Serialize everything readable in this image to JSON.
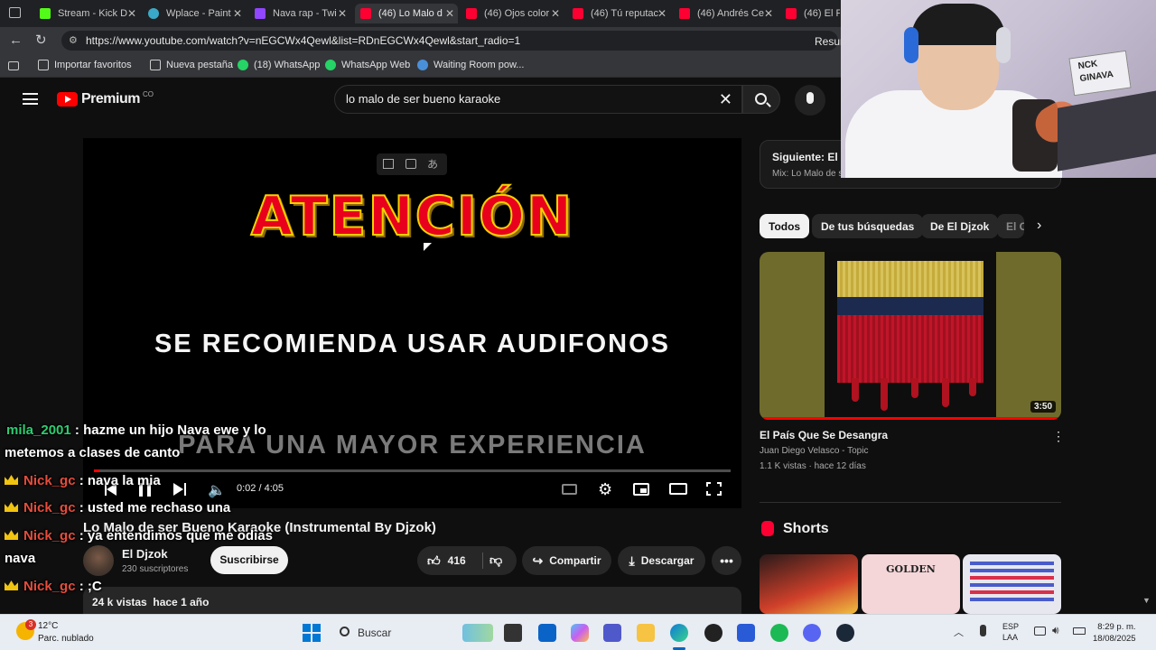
{
  "browser": {
    "tabs": [
      {
        "label": "Stream - Kick D",
        "color": "#53fc18"
      },
      {
        "label": "Wplace - Paint",
        "color": "#3aa9c9"
      },
      {
        "label": "Nava rap - Twi",
        "color": "#9146ff"
      },
      {
        "label": "(46) Lo Malo d",
        "color": "#ff0033",
        "active": true
      },
      {
        "label": "(46) Ojos color",
        "color": "#ff0033"
      },
      {
        "label": "(46) Tú reputac",
        "color": "#ff0033"
      },
      {
        "label": "(46) Andrés Ce",
        "color": "#ff0033"
      },
      {
        "label": "(46) El Pe",
        "color": "#ff0033"
      }
    ],
    "url": "https://www.youtube.com/watch?v=nEGCWx4Qewl&list=RDnEGCWx4Qewl&start_radio=1",
    "resume_label": "Resum",
    "bookmarks": [
      {
        "label": "Importar favoritos"
      },
      {
        "label": "Nueva pestaña"
      },
      {
        "label": "(18) WhatsApp"
      },
      {
        "label": "WhatsApp Web"
      },
      {
        "label": "Waiting Room pow..."
      }
    ]
  },
  "youtube": {
    "logo_label": "Premium",
    "logo_badge": "CO",
    "search_value": "lo malo de ser bueno karaoke",
    "player": {
      "line1": "ATENCIÓN",
      "line2": "SE RECOMIENDA USAR AUDIFONOS",
      "line3": "PARA UNA MAYOR EXPERIENCIA",
      "time": "0:02 / 4:05",
      "progress": 0.008
    },
    "video": {
      "title": "Lo Malo de ser Bueno Karaoke (Instrumental By Djzok)",
      "channel": "El Djzok",
      "subscribers": "230 suscriptores",
      "subscribe_label": "Suscribirse",
      "likes": "416",
      "share_label": "Compartir",
      "download_label": "Descargar",
      "views_date": "24 k vistas  hace 1 año"
    },
    "sidebar": {
      "next_label": "Siguiente: El C",
      "next_sub": "Mix: Lo Malo de s",
      "chips": [
        "Todos",
        "De tus búsquedas",
        "De El Djzok",
        "El C"
      ],
      "rec": {
        "title": "El País Que Se Desangra",
        "channel": "Juan Diego Velasco - Topic",
        "meta": "1.1 K vistas · hace 12 días",
        "duration": "3:50"
      },
      "shorts_label": "Shorts",
      "short2_text": "GOLDEN"
    }
  },
  "chat": [
    {
      "user": "mila_2001",
      "msg": ": hazme un hijo Nava ewe y lo",
      "crown": false
    },
    {
      "user": "",
      "msg": "metemos a clases de canto",
      "crown": false
    },
    {
      "user": "Nick_gc",
      "msg": ": nava la mia",
      "crown": true
    },
    {
      "user": "Nick_gc",
      "msg": ": usted me rechaso una",
      "crown": true
    },
    {
      "user": "Nick_gc",
      "msg": ": ya entendimos que me odias",
      "crown": true
    },
    {
      "user": "",
      "msg": "nava",
      "crown": false
    },
    {
      "user": "Nick_gc",
      "msg": ": ;C",
      "crown": true
    }
  ],
  "taskbar": {
    "weather_temp": "12°C",
    "weather_desc": "Parc. nublado",
    "weather_badge": "3",
    "search_label": "Buscar",
    "lang1": "ESP",
    "lang2": "LAA",
    "time": "8:29 p. m.",
    "date": "18/08/2025"
  },
  "webcam": {
    "sign_line1": "NCK",
    "sign_line2": "GINAVA"
  }
}
